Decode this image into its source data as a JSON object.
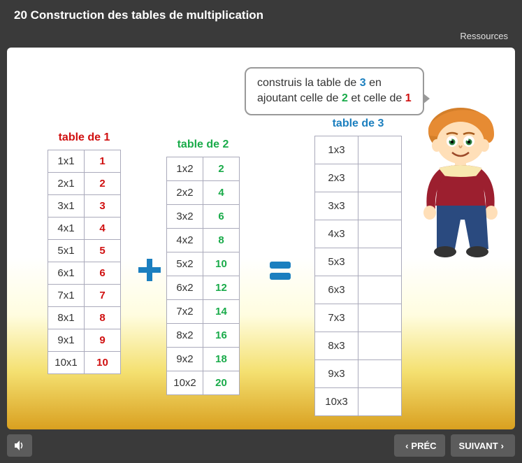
{
  "header": {
    "title": "20 Construction des tables de multiplication",
    "resources": "Ressources"
  },
  "instruction": {
    "line1_a": "construis la table de ",
    "line1_n": "3",
    "line1_b": " en",
    "line2_a": "ajoutant celle de ",
    "line2_n1": "2",
    "line2_b": " et celle de ",
    "line2_n2": "1"
  },
  "tables": {
    "t1": {
      "caption": "table de 1",
      "rows": [
        {
          "expr": "1x1",
          "val": "1"
        },
        {
          "expr": "2x1",
          "val": "2"
        },
        {
          "expr": "3x1",
          "val": "3"
        },
        {
          "expr": "4x1",
          "val": "4"
        },
        {
          "expr": "5x1",
          "val": "5"
        },
        {
          "expr": "6x1",
          "val": "6"
        },
        {
          "expr": "7x1",
          "val": "7"
        },
        {
          "expr": "8x1",
          "val": "8"
        },
        {
          "expr": "9x1",
          "val": "9"
        },
        {
          "expr": "10x1",
          "val": "10"
        }
      ]
    },
    "t2": {
      "caption": "table de 2",
      "rows": [
        {
          "expr": "1x2",
          "val": "2"
        },
        {
          "expr": "2x2",
          "val": "4"
        },
        {
          "expr": "3x2",
          "val": "6"
        },
        {
          "expr": "4x2",
          "val": "8"
        },
        {
          "expr": "5x2",
          "val": "10"
        },
        {
          "expr": "6x2",
          "val": "12"
        },
        {
          "expr": "7x2",
          "val": "14"
        },
        {
          "expr": "8x2",
          "val": "16"
        },
        {
          "expr": "9x2",
          "val": "18"
        },
        {
          "expr": "10x2",
          "val": "20"
        }
      ]
    },
    "t3": {
      "caption": "table de 3",
      "rows": [
        {
          "expr": "1x3",
          "val": ""
        },
        {
          "expr": "2x3",
          "val": ""
        },
        {
          "expr": "3x3",
          "val": ""
        },
        {
          "expr": "4x3",
          "val": ""
        },
        {
          "expr": "5x3",
          "val": ""
        },
        {
          "expr": "6x3",
          "val": ""
        },
        {
          "expr": "7x3",
          "val": ""
        },
        {
          "expr": "8x3",
          "val": ""
        },
        {
          "expr": "9x3",
          "val": ""
        },
        {
          "expr": "10x3",
          "val": ""
        }
      ]
    }
  },
  "footer": {
    "prev": "PRÉC",
    "next": "SUIVANT"
  }
}
